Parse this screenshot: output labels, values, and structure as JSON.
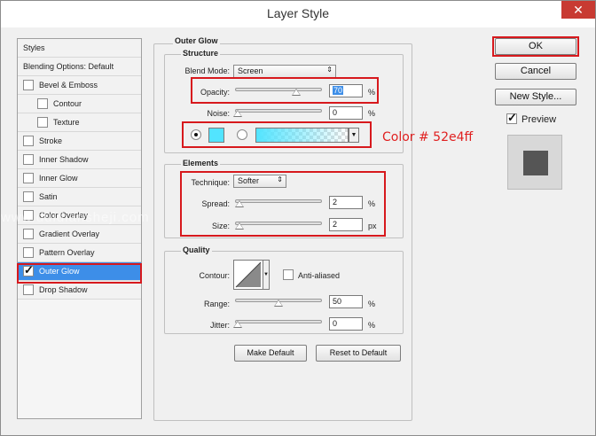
{
  "window": {
    "title": "Layer Style",
    "close_glyph": "✕"
  },
  "styles_list": {
    "items": [
      {
        "label": "Styles",
        "has_checkbox": false,
        "checked": false
      },
      {
        "label": "Blending Options: Default",
        "has_checkbox": false,
        "checked": false
      },
      {
        "label": "Bevel & Emboss",
        "has_checkbox": true,
        "checked": false
      },
      {
        "label": "Contour",
        "has_checkbox": true,
        "checked": false
      },
      {
        "label": "Texture",
        "has_checkbox": true,
        "checked": false
      },
      {
        "label": "Stroke",
        "has_checkbox": true,
        "checked": false
      },
      {
        "label": "Inner Shadow",
        "has_checkbox": true,
        "checked": false
      },
      {
        "label": "Inner Glow",
        "has_checkbox": true,
        "checked": false
      },
      {
        "label": "Satin",
        "has_checkbox": true,
        "checked": false
      },
      {
        "label": "Color Overlay",
        "has_checkbox": true,
        "checked": false
      },
      {
        "label": "Gradient Overlay",
        "has_checkbox": true,
        "checked": false
      },
      {
        "label": "Pattern Overlay",
        "has_checkbox": true,
        "checked": false
      },
      {
        "label": "Outer Glow",
        "has_checkbox": true,
        "checked": true,
        "selected": true
      },
      {
        "label": "Drop Shadow",
        "has_checkbox": true,
        "checked": false
      }
    ]
  },
  "outer_glow": {
    "section_title": "Outer Glow",
    "structure": {
      "title": "Structure",
      "blend_mode_label": "Blend Mode:",
      "blend_mode_value": "Screen",
      "opacity_label": "Opacity:",
      "opacity_value": "70",
      "opacity_unit": "%",
      "opacity_level": 0.7,
      "noise_label": "Noise:",
      "noise_value": "0",
      "noise_unit": "%",
      "glow_color": "#52e4ff",
      "color_mode": "solid"
    },
    "elements": {
      "title": "Elements",
      "technique_label": "Technique:",
      "technique_value": "Softer",
      "spread_label": "Spread:",
      "spread_value": "2",
      "spread_unit": "%",
      "size_label": "Size:",
      "size_value": "2",
      "size_unit": "px"
    },
    "quality": {
      "title": "Quality",
      "contour_label": "Contour:",
      "antialiased_label": "Anti-aliased",
      "antialiased_checked": false,
      "range_label": "Range:",
      "range_value": "50",
      "range_unit": "%",
      "jitter_label": "Jitter:",
      "jitter_value": "0",
      "jitter_unit": "%"
    },
    "make_default_label": "Make Default",
    "reset_default_label": "Reset to Default"
  },
  "actions": {
    "ok_label": "OK",
    "cancel_label": "Cancel",
    "new_style_label": "New Style...",
    "preview_label": "Preview",
    "preview_checked": true
  },
  "annotation": {
    "text": "Color # 52e4ff",
    "color": "#e02020"
  },
  "watermark": {
    "text": "www.duidiansheji.com"
  },
  "colors": {
    "highlight_red": "#d7191d",
    "selection_blue": "#3d8ee8",
    "preview_swatch": "#555555"
  }
}
